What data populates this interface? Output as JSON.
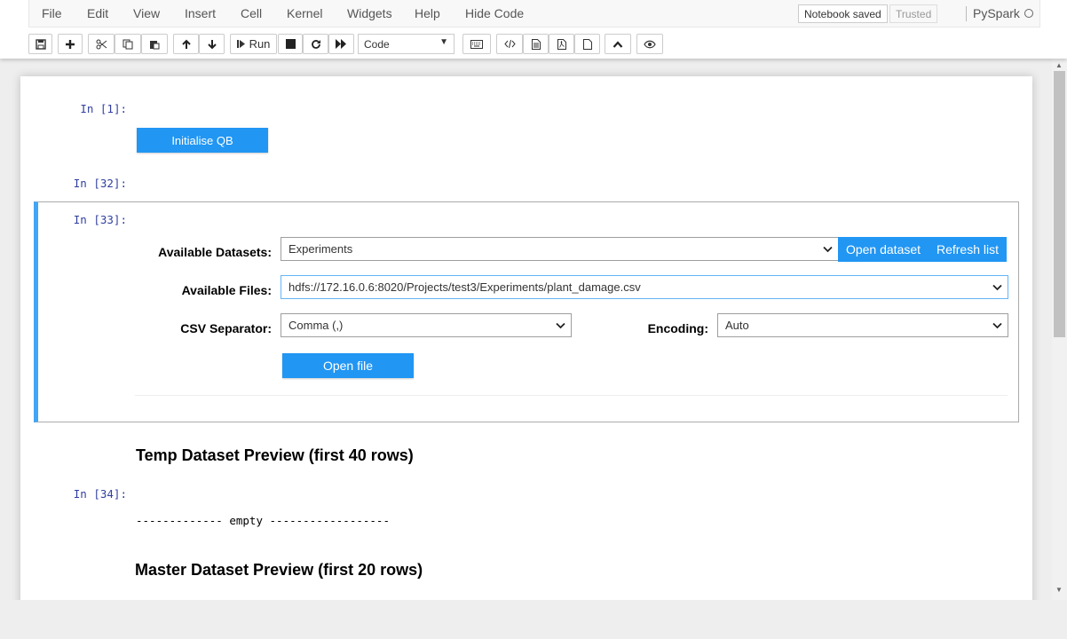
{
  "menubar": {
    "items": [
      "File",
      "Edit",
      "View",
      "Insert",
      "Cell",
      "Kernel",
      "Widgets",
      "Help",
      "Hide Code"
    ],
    "notification": "Notebook saved",
    "trusted": "Trusted",
    "kernel_name": "PySpark"
  },
  "toolbar": {
    "run_label": "Run",
    "cell_type": "Code",
    "icons": [
      "save-icon",
      "plus-icon",
      "cut-icon",
      "copy-icon",
      "paste-icon",
      "arrow-up-icon",
      "arrow-down-icon",
      "run-icon",
      "stop-icon",
      "restart-icon",
      "fast-forward-icon",
      "keyboard-icon",
      "code-icon",
      "file-icon",
      "pdf-icon",
      "page-icon",
      "chevron-up-icon",
      "eye-icon"
    ]
  },
  "cells": {
    "c1": {
      "prompt": "In [1]:",
      "button": "Initialise QB"
    },
    "c2": {
      "prompt": "In [32]:"
    },
    "c3": {
      "prompt": "In [33]:",
      "datasets_label": "Available Datasets:",
      "datasets_value": "Experiments",
      "open_dataset": "Open dataset",
      "refresh_list": "Refresh list",
      "files_label": "Available Files:",
      "files_value": "hdfs://172.16.0.6:8020/Projects/test3/Experiments/plant_damage.csv",
      "separator_label": "CSV Separator:",
      "separator_value": "Comma (,)",
      "encoding_label": "Encoding:",
      "encoding_value": "Auto",
      "open_file": "Open file"
    },
    "heading_temp": "Temp Dataset Preview (first 40 rows)",
    "c4": {
      "prompt": "In [34]:",
      "output": "------------- empty ------------------"
    },
    "heading_master": "Master Dataset Preview (first 20 rows)"
  },
  "colors": {
    "accent": "#2196f3",
    "selected_border": "#42a5f5",
    "prompt": "#303f9f"
  }
}
